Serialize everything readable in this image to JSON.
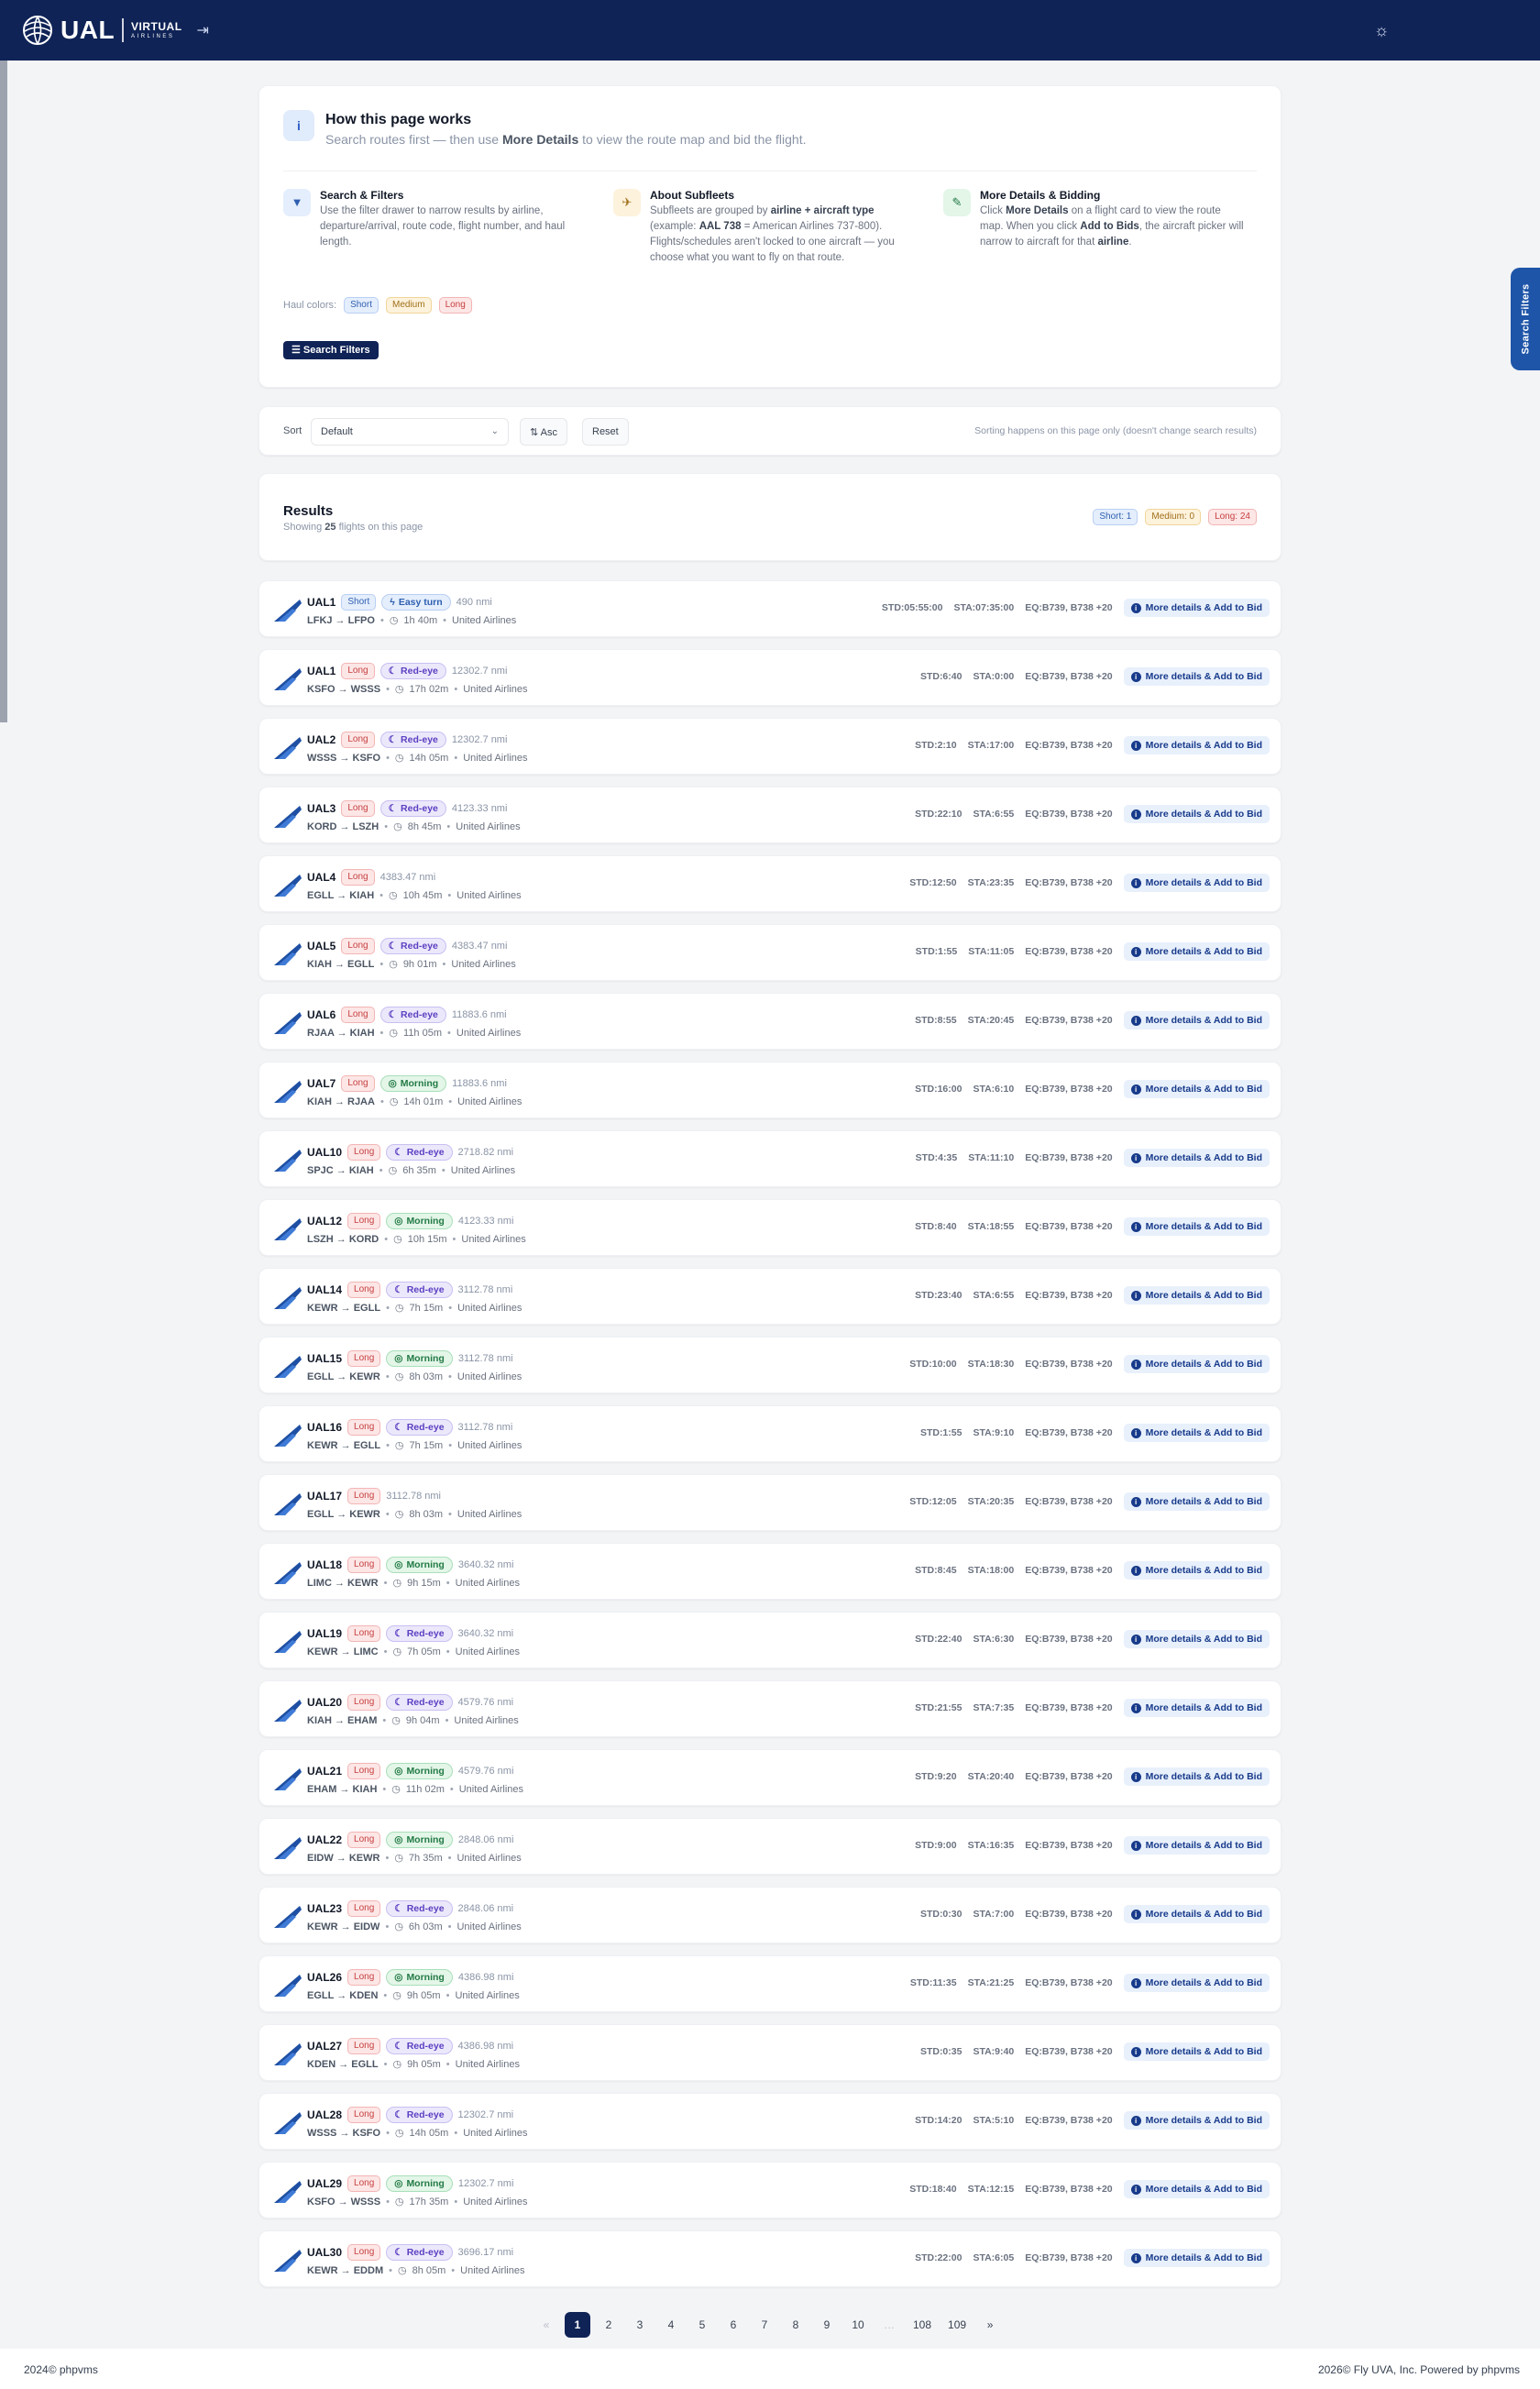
{
  "header": {
    "logo_text": "UAL",
    "logo_sub1": "VIRTUAL",
    "logo_sub2": "AIRLINES",
    "logout_icon": "logout-icon",
    "theme_icon": "sun-icon"
  },
  "filters_tab_label": "Search Filters",
  "how_it_works": {
    "title": "How this page works",
    "subtitle_pre": "Search routes first — then use ",
    "subtitle_bold": "More Details",
    "subtitle_post": " to view the route map and bid the flight.",
    "columns": [
      {
        "title": "Search & Filters",
        "body": "Use the filter drawer to narrow results by airline, departure/arrival, route code, flight number, and haul length.",
        "icon": "filter-icon"
      },
      {
        "title": "About Subfleets",
        "body_parts": [
          "Subfleets are grouped by ",
          "airline + aircraft type",
          " (example: ",
          "AAL 738",
          " = American Airlines 737-800). Flights/schedules aren't locked to one aircraft — you choose what you want to fly on that route."
        ],
        "icon": "plane-icon"
      },
      {
        "title": "More Details & Bidding",
        "body_parts": [
          "Click ",
          "More Details",
          " on a flight card to view the route map. When you click ",
          "Add to Bids",
          ", the aircraft picker will narrow to aircraft for that ",
          "airline",
          "."
        ],
        "icon": "edit-icon"
      }
    ],
    "haul_label": "Haul colors:",
    "haul_short": "Short",
    "haul_medium": "Medium",
    "haul_long": "Long",
    "search_button": "Search Filters"
  },
  "sort": {
    "label": "Sort",
    "value": "Default",
    "asc_label": "Asc",
    "reset_label": "Reset",
    "note": "Sorting happens on this page only (doesn't change search results)"
  },
  "results": {
    "title": "Results",
    "showing_pre": "Showing ",
    "showing_count": "25",
    "showing_post": " flights on this page",
    "count_short": "Short: 1",
    "count_medium": "Medium: 0",
    "count_long": "Long: 24"
  },
  "flights": [
    {
      "code": "UAL1",
      "haul": "Short",
      "tag": "Easy turn",
      "dist": "490 nmi",
      "route": "LFKJ → LFPO",
      "dur": "1h 40m",
      "airline": "United Airlines",
      "std": "STD:05:55:00",
      "sta": "STA:07:35:00",
      "eq": "EQ:B739, B738 +20"
    },
    {
      "code": "UAL1",
      "haul": "Long",
      "tag": "Red-eye",
      "dist": "12302.7 nmi",
      "route": "KSFO → WSSS",
      "dur": "17h 02m",
      "airline": "United Airlines",
      "std": "STD:6:40",
      "sta": "STA:0:00",
      "eq": "EQ:B739, B738 +20"
    },
    {
      "code": "UAL2",
      "haul": "Long",
      "tag": "Red-eye",
      "dist": "12302.7 nmi",
      "route": "WSSS → KSFO",
      "dur": "14h 05m",
      "airline": "United Airlines",
      "std": "STD:2:10",
      "sta": "STA:17:00",
      "eq": "EQ:B739, B738 +20"
    },
    {
      "code": "UAL3",
      "haul": "Long",
      "tag": "Red-eye",
      "dist": "4123.33 nmi",
      "route": "KORD → LSZH",
      "dur": "8h 45m",
      "airline": "United Airlines",
      "std": "STD:22:10",
      "sta": "STA:6:55",
      "eq": "EQ:B739, B738 +20"
    },
    {
      "code": "UAL4",
      "haul": "Long",
      "tag": "",
      "dist": "4383.47 nmi",
      "route": "EGLL → KIAH",
      "dur": "10h 45m",
      "airline": "United Airlines",
      "std": "STD:12:50",
      "sta": "STA:23:35",
      "eq": "EQ:B739, B738 +20"
    },
    {
      "code": "UAL5",
      "haul": "Long",
      "tag": "Red-eye",
      "dist": "4383.47 nmi",
      "route": "KIAH → EGLL",
      "dur": "9h 01m",
      "airline": "United Airlines",
      "std": "STD:1:55",
      "sta": "STA:11:05",
      "eq": "EQ:B739, B738 +20"
    },
    {
      "code": "UAL6",
      "haul": "Long",
      "tag": "Red-eye",
      "dist": "11883.6 nmi",
      "route": "RJAA → KIAH",
      "dur": "11h 05m",
      "airline": "United Airlines",
      "std": "STD:8:55",
      "sta": "STA:20:45",
      "eq": "EQ:B739, B738 +20"
    },
    {
      "code": "UAL7",
      "haul": "Long",
      "tag": "Morning",
      "dist": "11883.6 nmi",
      "route": "KIAH → RJAA",
      "dur": "14h 01m",
      "airline": "United Airlines",
      "std": "STD:16:00",
      "sta": "STA:6:10",
      "eq": "EQ:B739, B738 +20"
    },
    {
      "code": "UAL10",
      "haul": "Long",
      "tag": "Red-eye",
      "dist": "2718.82 nmi",
      "route": "SPJC → KIAH",
      "dur": "6h 35m",
      "airline": "United Airlines",
      "std": "STD:4:35",
      "sta": "STA:11:10",
      "eq": "EQ:B739, B738 +20"
    },
    {
      "code": "UAL12",
      "haul": "Long",
      "tag": "Morning",
      "dist": "4123.33 nmi",
      "route": "LSZH → KORD",
      "dur": "10h 15m",
      "airline": "United Airlines",
      "std": "STD:8:40",
      "sta": "STA:18:55",
      "eq": "EQ:B739, B738 +20"
    },
    {
      "code": "UAL14",
      "haul": "Long",
      "tag": "Red-eye",
      "dist": "3112.78 nmi",
      "route": "KEWR → EGLL",
      "dur": "7h 15m",
      "airline": "United Airlines",
      "std": "STD:23:40",
      "sta": "STA:6:55",
      "eq": "EQ:B739, B738 +20"
    },
    {
      "code": "UAL15",
      "haul": "Long",
      "tag": "Morning",
      "dist": "3112.78 nmi",
      "route": "EGLL → KEWR",
      "dur": "8h 03m",
      "airline": "United Airlines",
      "std": "STD:10:00",
      "sta": "STA:18:30",
      "eq": "EQ:B739, B738 +20"
    },
    {
      "code": "UAL16",
      "haul": "Long",
      "tag": "Red-eye",
      "dist": "3112.78 nmi",
      "route": "KEWR → EGLL",
      "dur": "7h 15m",
      "airline": "United Airlines",
      "std": "STD:1:55",
      "sta": "STA:9:10",
      "eq": "EQ:B739, B738 +20"
    },
    {
      "code": "UAL17",
      "haul": "Long",
      "tag": "",
      "dist": "3112.78 nmi",
      "route": "EGLL → KEWR",
      "dur": "8h 03m",
      "airline": "United Airlines",
      "std": "STD:12:05",
      "sta": "STA:20:35",
      "eq": "EQ:B739, B738 +20"
    },
    {
      "code": "UAL18",
      "haul": "Long",
      "tag": "Morning",
      "dist": "3640.32 nmi",
      "route": "LIMC → KEWR",
      "dur": "9h 15m",
      "airline": "United Airlines",
      "std": "STD:8:45",
      "sta": "STA:18:00",
      "eq": "EQ:B739, B738 +20"
    },
    {
      "code": "UAL19",
      "haul": "Long",
      "tag": "Red-eye",
      "dist": "3640.32 nmi",
      "route": "KEWR → LIMC",
      "dur": "7h 05m",
      "airline": "United Airlines",
      "std": "STD:22:40",
      "sta": "STA:6:30",
      "eq": "EQ:B739, B738 +20"
    },
    {
      "code": "UAL20",
      "haul": "Long",
      "tag": "Red-eye",
      "dist": "4579.76 nmi",
      "route": "KIAH → EHAM",
      "dur": "9h 04m",
      "airline": "United Airlines",
      "std": "STD:21:55",
      "sta": "STA:7:35",
      "eq": "EQ:B739, B738 +20"
    },
    {
      "code": "UAL21",
      "haul": "Long",
      "tag": "Morning",
      "dist": "4579.76 nmi",
      "route": "EHAM → KIAH",
      "dur": "11h 02m",
      "airline": "United Airlines",
      "std": "STD:9:20",
      "sta": "STA:20:40",
      "eq": "EQ:B739, B738 +20"
    },
    {
      "code": "UAL22",
      "haul": "Long",
      "tag": "Morning",
      "dist": "2848.06 nmi",
      "route": "EIDW → KEWR",
      "dur": "7h 35m",
      "airline": "United Airlines",
      "std": "STD:9:00",
      "sta": "STA:16:35",
      "eq": "EQ:B739, B738 +20"
    },
    {
      "code": "UAL23",
      "haul": "Long",
      "tag": "Red-eye",
      "dist": "2848.06 nmi",
      "route": "KEWR → EIDW",
      "dur": "6h 03m",
      "airline": "United Airlines",
      "std": "STD:0:30",
      "sta": "STA:7:00",
      "eq": "EQ:B739, B738 +20"
    },
    {
      "code": "UAL26",
      "haul": "Long",
      "tag": "Morning",
      "dist": "4386.98 nmi",
      "route": "EGLL → KDEN",
      "dur": "9h 05m",
      "airline": "United Airlines",
      "std": "STD:11:35",
      "sta": "STA:21:25",
      "eq": "EQ:B739, B738 +20"
    },
    {
      "code": "UAL27",
      "haul": "Long",
      "tag": "Red-eye",
      "dist": "4386.98 nmi",
      "route": "KDEN → EGLL",
      "dur": "9h 05m",
      "airline": "United Airlines",
      "std": "STD:0:35",
      "sta": "STA:9:40",
      "eq": "EQ:B739, B738 +20"
    },
    {
      "code": "UAL28",
      "haul": "Long",
      "tag": "Red-eye",
      "dist": "12302.7 nmi",
      "route": "WSSS → KSFO",
      "dur": "14h 05m",
      "airline": "United Airlines",
      "std": "STD:14:20",
      "sta": "STA:5:10",
      "eq": "EQ:B739, B738 +20"
    },
    {
      "code": "UAL29",
      "haul": "Long",
      "tag": "Morning",
      "dist": "12302.7 nmi",
      "route": "KSFO → WSSS",
      "dur": "17h 35m",
      "airline": "United Airlines",
      "std": "STD:18:40",
      "sta": "STA:12:15",
      "eq": "EQ:B739, B738 +20"
    },
    {
      "code": "UAL30",
      "haul": "Long",
      "tag": "Red-eye",
      "dist": "3696.17 nmi",
      "route": "KEWR → EDDM",
      "dur": "8h 05m",
      "airline": "United Airlines",
      "std": "STD:22:00",
      "sta": "STA:6:05",
      "eq": "EQ:B739, B738 +20"
    }
  ],
  "details_button": "More details & Add to Bid",
  "pagination": [
    "«",
    "1",
    "2",
    "3",
    "4",
    "5",
    "6",
    "7",
    "8",
    "9",
    "10",
    "…",
    "108",
    "109",
    "»"
  ],
  "pagination_current": "1",
  "footer": {
    "left": "2024© phpvms",
    "right": "2026© Fly UVA, Inc.   Powered by phpvms"
  },
  "colors": {
    "navy": "#0f2356",
    "short": "#2f5fb0",
    "medium": "#a0701b",
    "long": "#c64040",
    "redeye": "#5b3fc2",
    "morning": "#237a45"
  }
}
